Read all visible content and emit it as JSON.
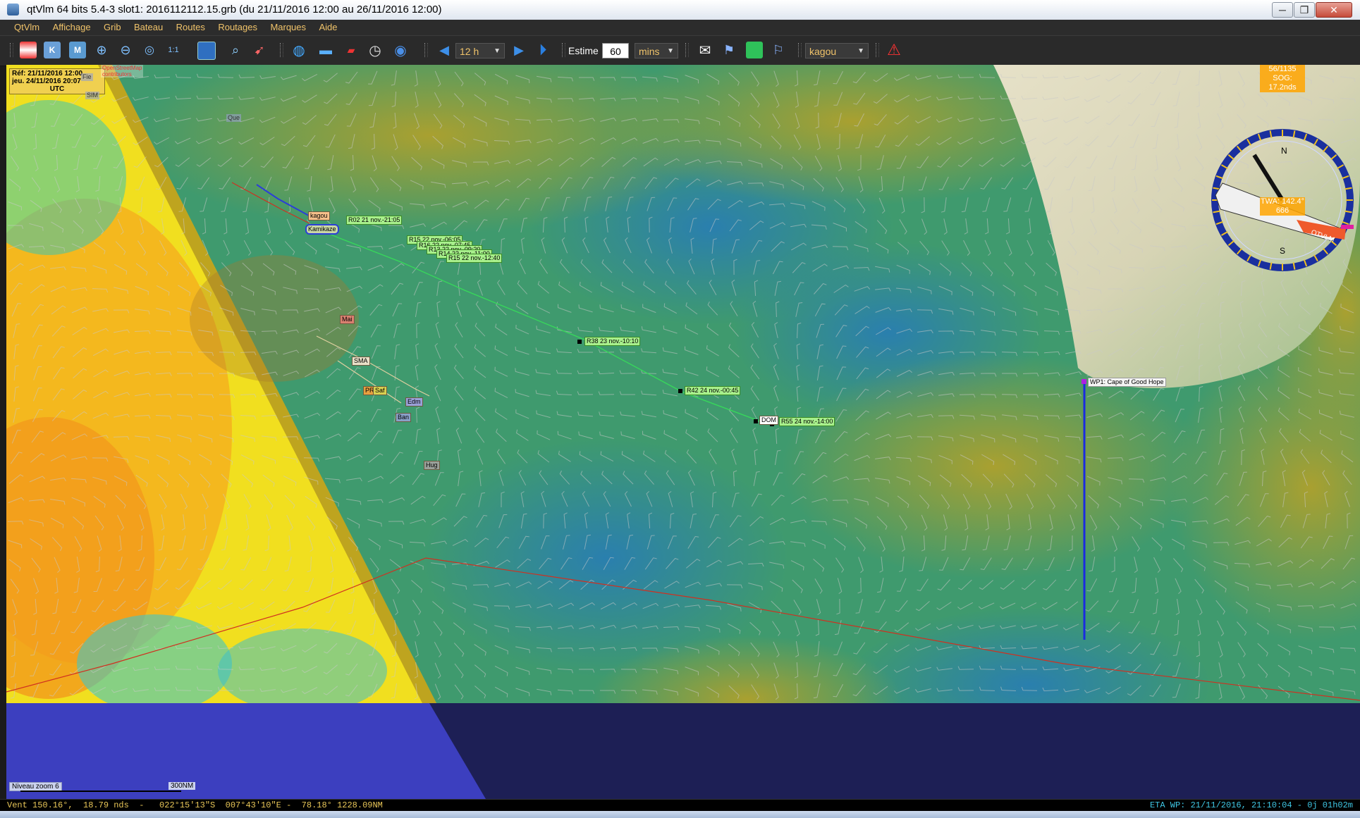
{
  "window": {
    "title": "qtVlm 64 bits 5.4-3 slot1: 2016112112.15.grb (du 21/11/2016 12:00 au 26/11/2016 12:00)",
    "controls": {
      "minimize": "─",
      "restore": "❐",
      "close": "✕"
    }
  },
  "menu": [
    "QtVlm",
    "Affichage",
    "Grib",
    "Bateau",
    "Routes",
    "Routages",
    "Marques",
    "Aide"
  ],
  "toolbar": {
    "step": "12 h",
    "estime_label": "Estime",
    "estime_value": "60",
    "estime_unit": "mins",
    "boat": "kagou",
    "icons": [
      "lighthouse-icon",
      "grib-k-icon",
      "grib-m-icon",
      "zoom-in-icon",
      "zoom-out-icon",
      "zoom-fit-icon",
      "zoom-one-icon",
      "select-area-icon",
      "search-icon",
      "compass-tool-icon",
      "globe-icon",
      "boat-icon",
      "ruler-icon",
      "clock-icon",
      "refresh-icon",
      "step-back-icon",
      "step-forward-icon",
      "play-icon",
      "email-icon",
      "route-icon",
      "green-square-icon",
      "routing-icon",
      "warning-icon"
    ]
  },
  "map": {
    "ref_info": [
      "Réf: 21/11/2016 12:00",
      "jeu. 24/11/2016 20:07",
      "UTC"
    ],
    "osm_attribution": [
      "OpenStreetMap",
      "contributors"
    ],
    "corner_tags": [
      "Fie",
      "SIM",
      "Que"
    ],
    "boats": [
      {
        "label": "kagou"
      },
      {
        "label": "Kamikaze"
      },
      {
        "label": "Mai"
      },
      {
        "label": "SMA"
      },
      {
        "label": "PRE"
      },
      {
        "label": "Saf"
      },
      {
        "label": "Edm"
      },
      {
        "label": "Ban"
      },
      {
        "label": "Hug"
      },
      {
        "label": "DOM"
      }
    ],
    "route_points": [
      "R02 21 nov.-21:05",
      "R15 22 nov.-06:05",
      "R16 22 nov.-07:45",
      "R13 22 nov.-09:20",
      "R14 22 nov.-11:00",
      "R15 22 nov.-12:40",
      "R38 23 nov.-10:10",
      "R42 24 nov.-00:45",
      "R55 24 nov.-14:00"
    ],
    "waypoint": "WP1: Cape of Good Hope",
    "zoom_label": "Niveau zoom 6",
    "scale_label": "300NM",
    "compass": {
      "top_info": [
        "56/1135",
        "SOG: 17.2nds"
      ],
      "bottom_info": [
        "TWA: 142.4°",
        "666"
      ],
      "cardinals": {
        "north": "N",
        "south": "S"
      },
      "boat_name": "OTVLM"
    }
  },
  "status": {
    "left": "Vent 150.16°,  18.79 nds  -   022°15'13\"S  007°43'10\"E -  78.18° 1228.09NM",
    "right": "ETA WP: 21/11/2016, 21:10:04 - 0j 01h02m"
  },
  "colors": {
    "wind_light": "#3f9a6e",
    "wind_medium": "#8aa238",
    "wind_strong": "#f0e020",
    "wind_very_strong": "#f39a1c",
    "ocean_low": "#2b78a8",
    "menu_text": "#f0c36a",
    "route_green": "#37d95a",
    "waypoint_blue": "#1a2be0"
  }
}
